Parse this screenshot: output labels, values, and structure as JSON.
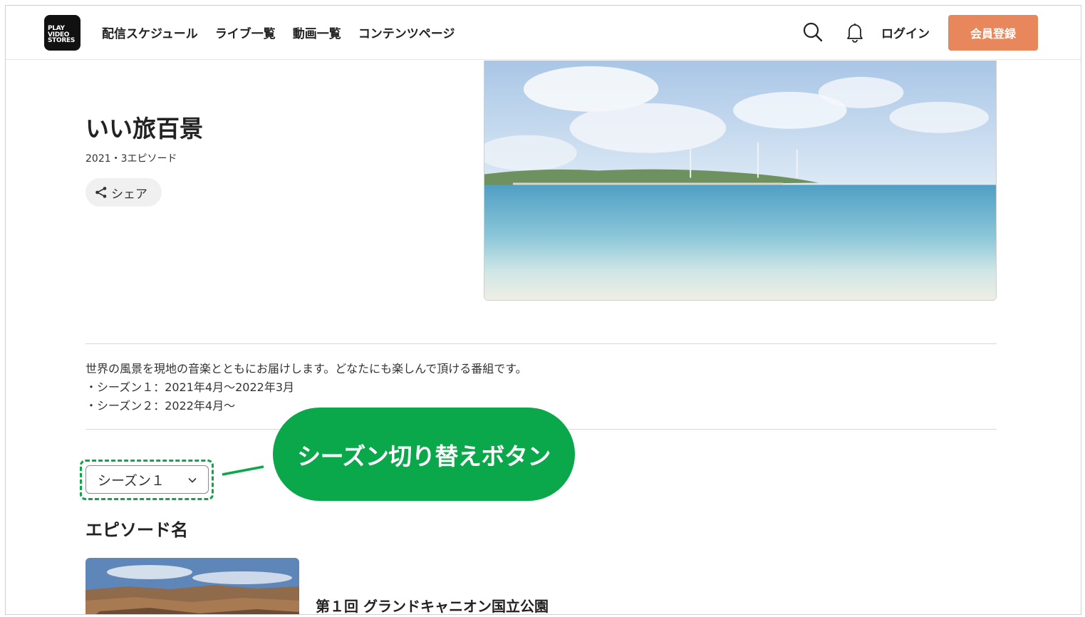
{
  "brand": {
    "logo_lines": [
      "PLAY",
      "VIDEO",
      "STORES"
    ]
  },
  "nav": {
    "items": [
      {
        "label": "配信スケジュール"
      },
      {
        "label": "ライブ一覧"
      },
      {
        "label": "動画一覧"
      },
      {
        "label": "コンテンツページ"
      }
    ]
  },
  "header": {
    "search_icon": "search-icon",
    "bell_icon": "bell-icon",
    "login_label": "ログイン",
    "signup_label": "会員登録",
    "signup_color": "#e8865c"
  },
  "program": {
    "title": "いい旅百景",
    "meta": "2021・3エピソード",
    "share_label": "シェア",
    "description": [
      "世界の風景を現地の音楽とともにお届けします。どなたにも楽しんで頂ける番組です。",
      "・シーズン１：2021年4月～2022年3月",
      "・シーズン２：2022年4月～"
    ]
  },
  "season_select": {
    "value": "シーズン１"
  },
  "callout": {
    "text": "シーズン切り替えボタン",
    "color": "#0aa84a"
  },
  "episodes": {
    "heading": "エピソード名",
    "items": [
      {
        "title": "第１回 グランドキャニオン国立公園"
      }
    ]
  }
}
